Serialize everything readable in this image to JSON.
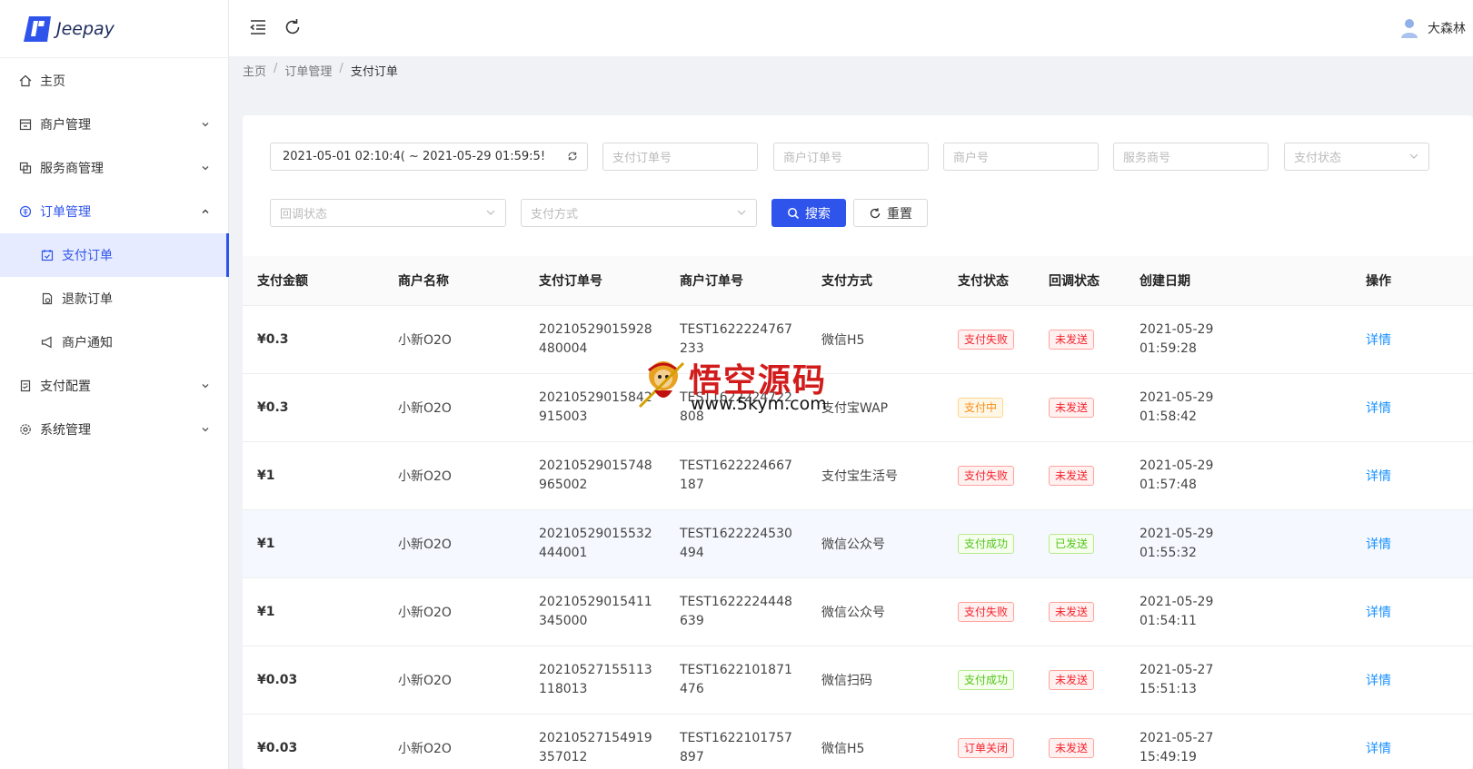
{
  "app": {
    "logo_text": "Jeepay",
    "user_name": "大森林",
    "accent": "#2f54eb"
  },
  "sidebar": {
    "items": [
      {
        "label": "主页",
        "icon": "home-icon"
      },
      {
        "label": "商户管理",
        "icon": "shop-icon"
      },
      {
        "label": "服务商管理",
        "icon": "copy-icon"
      },
      {
        "label": "订单管理",
        "icon": "account-book-icon"
      },
      {
        "label": "支付订单",
        "icon": "calendar-icon"
      },
      {
        "label": "退款订单",
        "icon": "file-sync-icon"
      },
      {
        "label": "商户通知",
        "icon": "notification-icon"
      },
      {
        "label": "支付配置",
        "icon": "file-done-icon"
      },
      {
        "label": "系统管理",
        "icon": "setting-icon"
      }
    ]
  },
  "breadcrumb": [
    "主页",
    "订单管理",
    "支付订单"
  ],
  "filters": {
    "date_range": "2021-05-01 02:10:4( ~ 2021-05-29 01:59:5!",
    "pay_order_no": "支付订单号",
    "mch_order_no": "商户订单号",
    "mch_no": "商户号",
    "isv_no": "服务商号",
    "pay_state": "支付状态",
    "notify_state": "回调状态",
    "pay_way": "支付方式",
    "search_label": "搜索",
    "reset_label": "重置"
  },
  "table": {
    "headers": [
      "支付金额",
      "商户名称",
      "支付订单号",
      "商户订单号",
      "支付方式",
      "支付状态",
      "回调状态",
      "创建日期",
      "操作"
    ],
    "rows": [
      {
        "amount": "¥0.3",
        "mch_name": "小新O2O",
        "pay_order_no": "20210529015928480004",
        "mch_order_no": "TEST1622224767233",
        "pay_way": "微信H5",
        "pay_state": "支付失败",
        "pay_state_color": "red",
        "notify_state": "未发送",
        "notify_color": "red",
        "created_date": "2021-05-29",
        "created_time": "01:59:28",
        "action": "详情"
      },
      {
        "amount": "¥0.3",
        "mch_name": "小新O2O",
        "pay_order_no": "20210529015842915003",
        "mch_order_no": "TEST1622224722808",
        "pay_way": "支付宝WAP",
        "pay_state": "支付中",
        "pay_state_color": "orange",
        "notify_state": "未发送",
        "notify_color": "red",
        "created_date": "2021-05-29",
        "created_time": "01:58:42",
        "action": "详情"
      },
      {
        "amount": "¥1",
        "mch_name": "小新O2O",
        "pay_order_no": "20210529015748965002",
        "mch_order_no": "TEST1622224667187",
        "pay_way": "支付宝生活号",
        "pay_state": "支付失败",
        "pay_state_color": "red",
        "notify_state": "未发送",
        "notify_color": "red",
        "created_date": "2021-05-29",
        "created_time": "01:57:48",
        "action": "详情"
      },
      {
        "amount": "¥1",
        "mch_name": "小新O2O",
        "pay_order_no": "20210529015532444001",
        "mch_order_no": "TEST1622224530494",
        "pay_way": "微信公众号",
        "pay_state": "支付成功",
        "pay_state_color": "green",
        "notify_state": "已发送",
        "notify_color": "green",
        "created_date": "2021-05-29",
        "created_time": "01:55:32",
        "action": "详情"
      },
      {
        "amount": "¥1",
        "mch_name": "小新O2O",
        "pay_order_no": "20210529015411345000",
        "mch_order_no": "TEST1622224448639",
        "pay_way": "微信公众号",
        "pay_state": "支付失败",
        "pay_state_color": "red",
        "notify_state": "未发送",
        "notify_color": "red",
        "created_date": "2021-05-29",
        "created_time": "01:54:11",
        "action": "详情"
      },
      {
        "amount": "¥0.03",
        "mch_name": "小新O2O",
        "pay_order_no": "20210527155113118013",
        "mch_order_no": "TEST1622101871476",
        "pay_way": "微信扫码",
        "pay_state": "支付成功",
        "pay_state_color": "green",
        "notify_state": "未发送",
        "notify_color": "red",
        "created_date": "2021-05-27",
        "created_time": "15:51:13",
        "action": "详情"
      },
      {
        "amount": "¥0.03",
        "mch_name": "小新O2O",
        "pay_order_no": "20210527154919357012",
        "mch_order_no": "TEST1622101757897",
        "pay_way": "微信H5",
        "pay_state": "订单关闭",
        "pay_state_color": "red",
        "notify_state": "未发送",
        "notify_color": "red",
        "created_date": "2021-05-27",
        "created_time": "15:49:19",
        "action": "详情"
      }
    ]
  },
  "watermark": {
    "title": "悟空源码",
    "url": "www.5kym.com"
  }
}
